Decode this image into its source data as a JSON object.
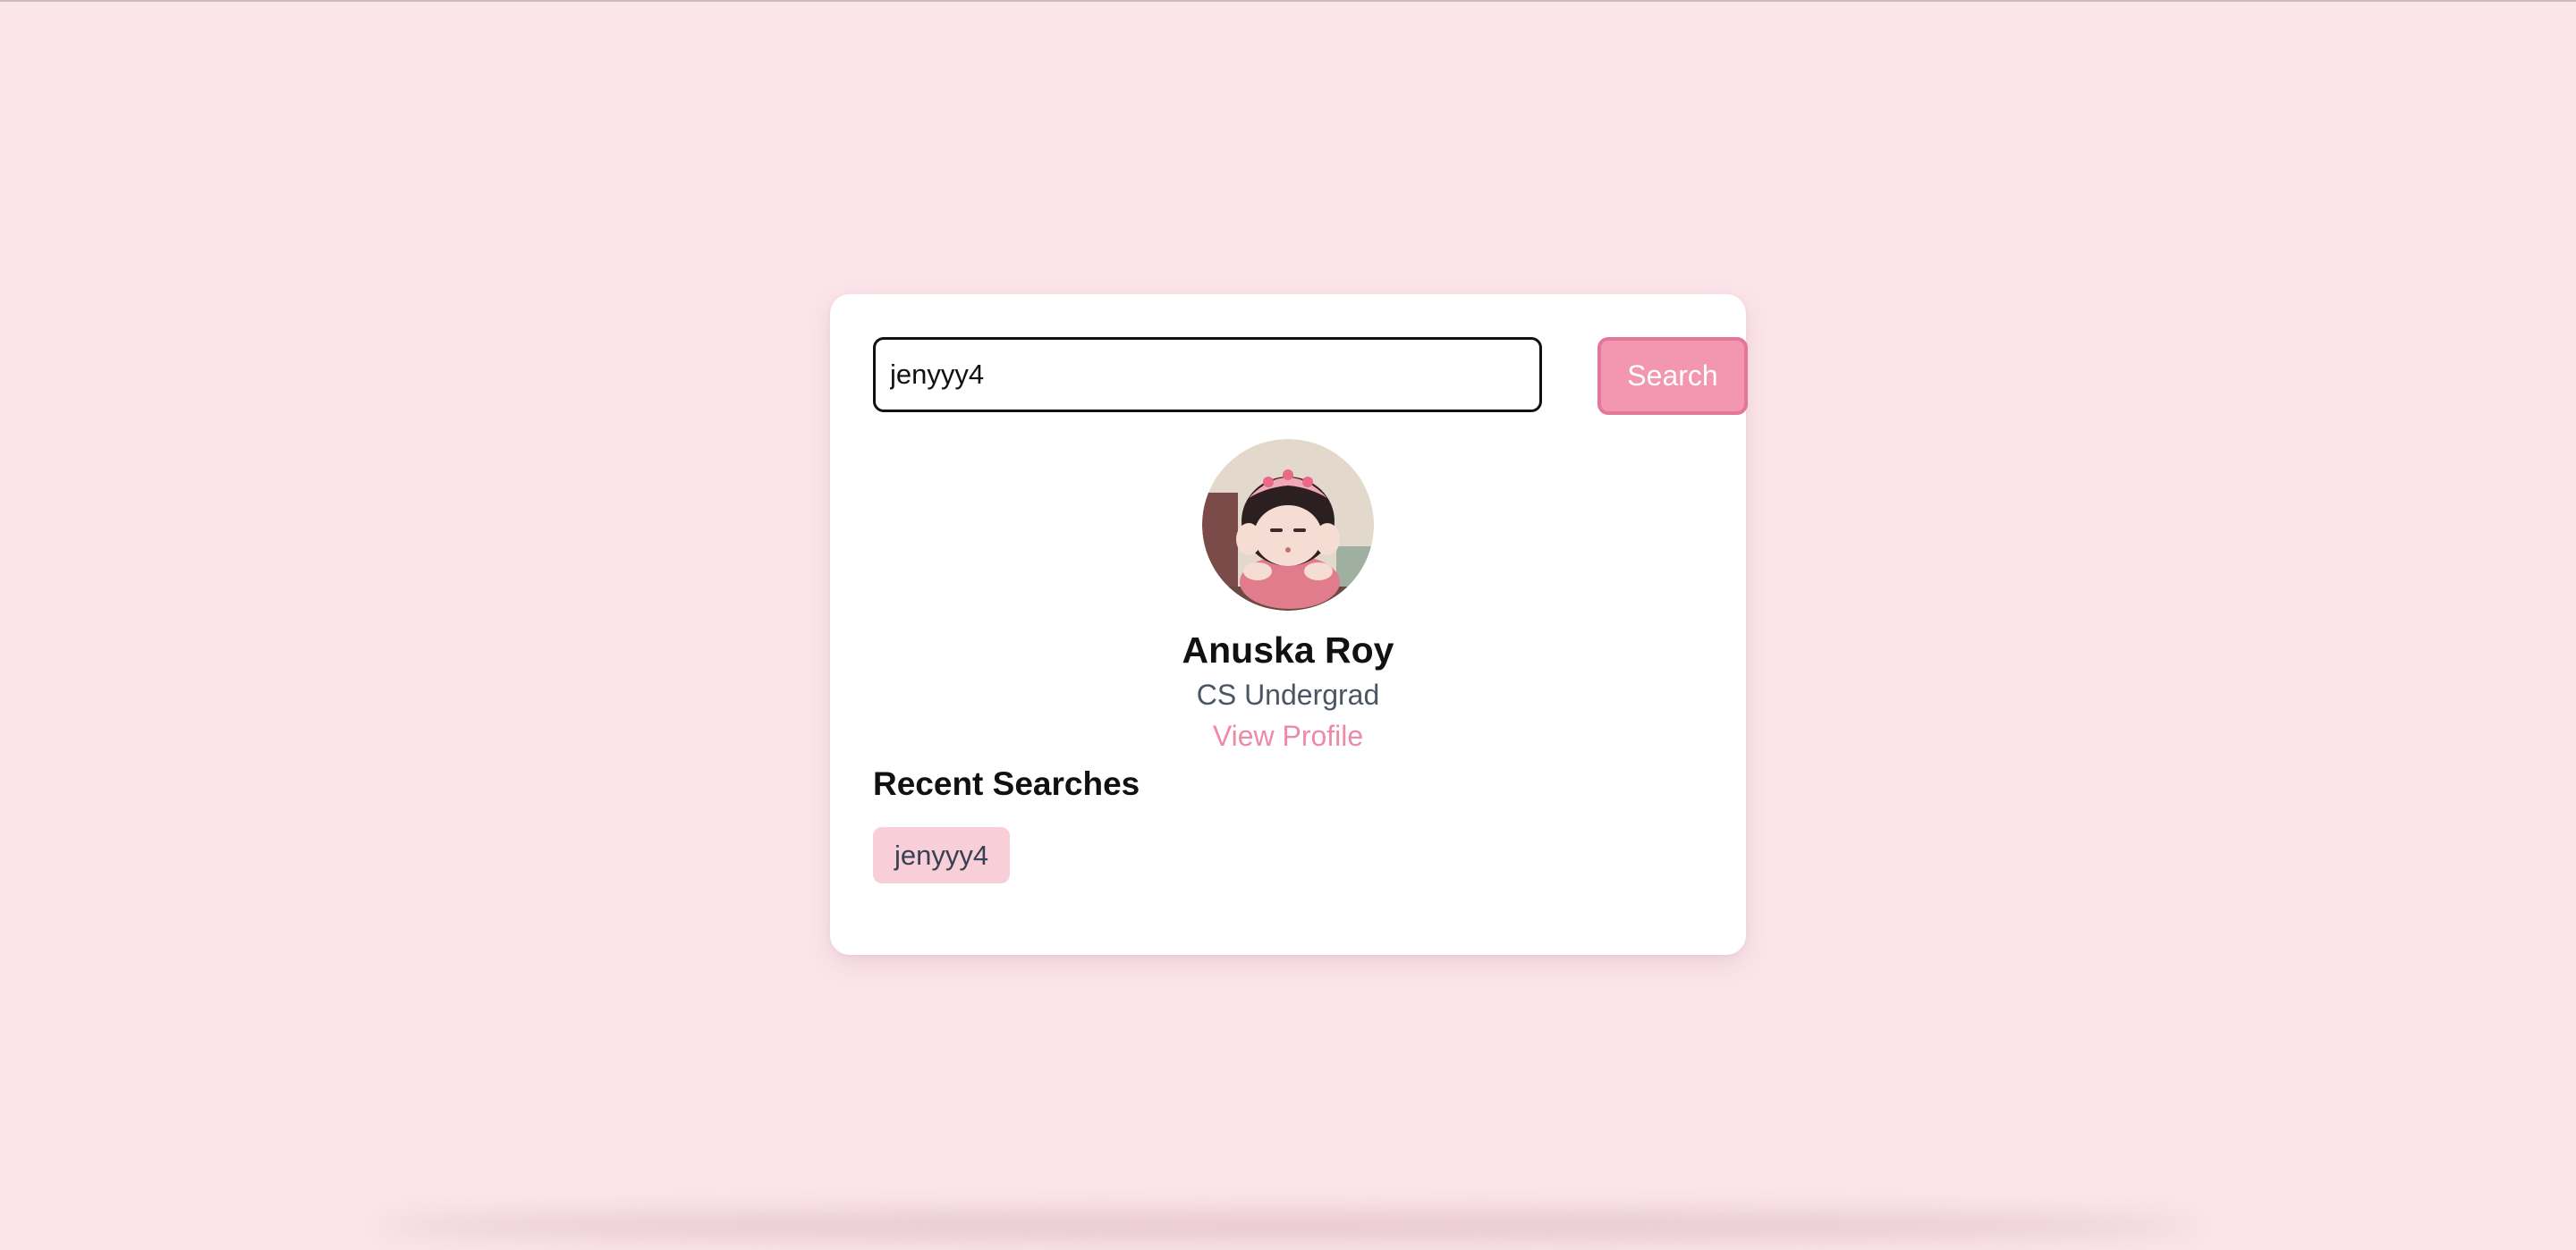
{
  "search": {
    "value": "jenyyy4",
    "button_label": "Search"
  },
  "profile": {
    "name": "Anuska Roy",
    "role": "CS Undergrad",
    "link_label": "View Profile"
  },
  "recent": {
    "title": "Recent Searches",
    "items": [
      "jenyyy4"
    ]
  },
  "colors": {
    "page_background": "#fbe5ea",
    "accent": "#f396b0",
    "link": "#ee8aa8",
    "chip": "#f8cfd9"
  }
}
